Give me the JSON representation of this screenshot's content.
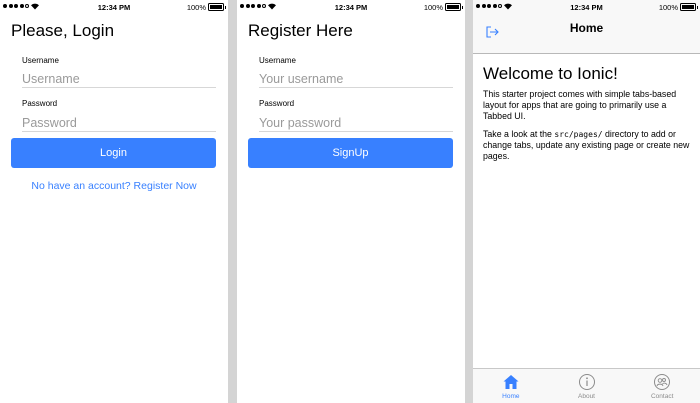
{
  "status_bar": {
    "time": "12:34 PM",
    "battery": "100%"
  },
  "login": {
    "title": "Please, Login",
    "username_label": "Username",
    "username_placeholder": "Username",
    "password_label": "Password",
    "password_placeholder": "Password",
    "login_button": "Login",
    "register_link": "No have an account? Register Now"
  },
  "register": {
    "title": "Register Here",
    "username_label": "Username",
    "username_placeholder": "Your username",
    "password_label": "Password",
    "password_placeholder": "Your password",
    "signup_button": "SignUp"
  },
  "home": {
    "header_title": "Home",
    "welcome": "Welcome to Ionic!",
    "para1": "This starter project comes with simple tabs-based layout for apps that are going to primarily use a Tabbed UI.",
    "para2_prefix": "Take a look at the ",
    "para2_code": "src/pages/",
    "para2_suffix": " directory to add or change tabs, update any existing page or create new pages.",
    "tabs": [
      {
        "label": "Home",
        "icon": "home-icon",
        "active": true
      },
      {
        "label": "About",
        "icon": "info-icon",
        "active": false
      },
      {
        "label": "Contact",
        "icon": "contacts-icon",
        "active": false
      }
    ]
  },
  "colors": {
    "primary": "#3880ff"
  }
}
